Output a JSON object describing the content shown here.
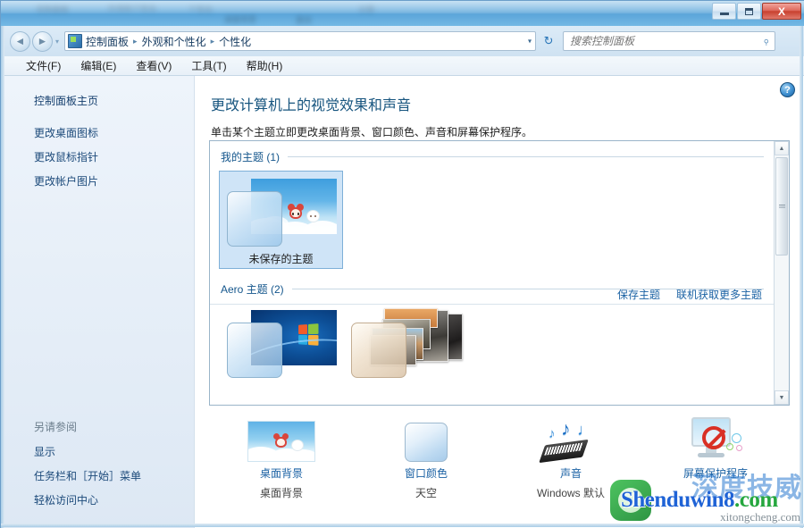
{
  "window": {
    "minimize_label": "最小化",
    "maximize_label": "最大化",
    "close_label": "X",
    "glass_ghost_text": [
      "控制面板",
      "外观和个性化",
      "个性化",
      "桌面背景",
      "更改",
      "主题"
    ]
  },
  "nav": {
    "back_glyph": "◄",
    "forward_glyph": "►",
    "history_glyph": "▾",
    "address_icon": "control-panel-icon",
    "breadcrumb": [
      "控制面板",
      "外观和个性化",
      "个性化"
    ],
    "breadcrumb_sep": "▸",
    "dropdown_glyph": "▾",
    "refresh_glyph": "↻",
    "search_placeholder": "搜索控制面板",
    "search_value": "",
    "search_icon": "search-icon"
  },
  "menubar": {
    "items": [
      {
        "label": "文件(F)"
      },
      {
        "label": "编辑(E)"
      },
      {
        "label": "查看(V)"
      },
      {
        "label": "工具(T)"
      },
      {
        "label": "帮助(H)"
      }
    ]
  },
  "sidebar": {
    "home_label": "控制面板主页",
    "items": [
      {
        "label": "更改桌面图标"
      },
      {
        "label": "更改鼠标指针"
      },
      {
        "label": "更改帐户图片"
      }
    ],
    "see_also_title": "另请参阅",
    "see_also_items": [
      {
        "label": "显示"
      },
      {
        "label": "任务栏和［开始］菜单"
      },
      {
        "label": "轻松访问中心"
      }
    ]
  },
  "content": {
    "help_glyph": "?",
    "title": "更改计算机上的视觉效果和声音",
    "subtitle": "单击某个主题立即更改桌面背景、窗口颜色、声音和屏幕保护程序。",
    "groups": [
      {
        "title": "我的主题 (1)",
        "themes": [
          {
            "label": "未保存的主题",
            "selected": true,
            "thumb": "sky-bear-wallpaper"
          }
        ]
      },
      {
        "title": "Aero 主题 (2)",
        "themes": [
          {
            "label": "",
            "selected": false,
            "thumb": "windows7-default"
          },
          {
            "label": "",
            "selected": false,
            "thumb": "landscapes-stack"
          }
        ]
      }
    ],
    "panel_links": [
      {
        "label": "保存主题"
      },
      {
        "label": "联机获取更多主题"
      }
    ],
    "scrollbar": {
      "up_glyph": "▲",
      "down_glyph": "▼"
    }
  },
  "settings": [
    {
      "icon": "desktop-background-icon",
      "label": "桌面背景",
      "value": "桌面背景"
    },
    {
      "icon": "window-color-icon",
      "label": "窗口颜色",
      "value": "天空"
    },
    {
      "icon": "sound-icon",
      "label": "声音",
      "value": "Windows 默认"
    },
    {
      "icon": "screensaver-icon",
      "label": "屏幕保护程序",
      "value": ""
    }
  ],
  "watermark": {
    "text_blue": "Shenduwin8",
    "text_green": ".com",
    "subtext": "xitongcheng.com",
    "cn_text": "深度技威"
  },
  "colors": {
    "accent_link": "#1b62a4",
    "title_blue": "#17557f",
    "selection": "#cfe4f7",
    "frame": "#6b9ec9"
  }
}
